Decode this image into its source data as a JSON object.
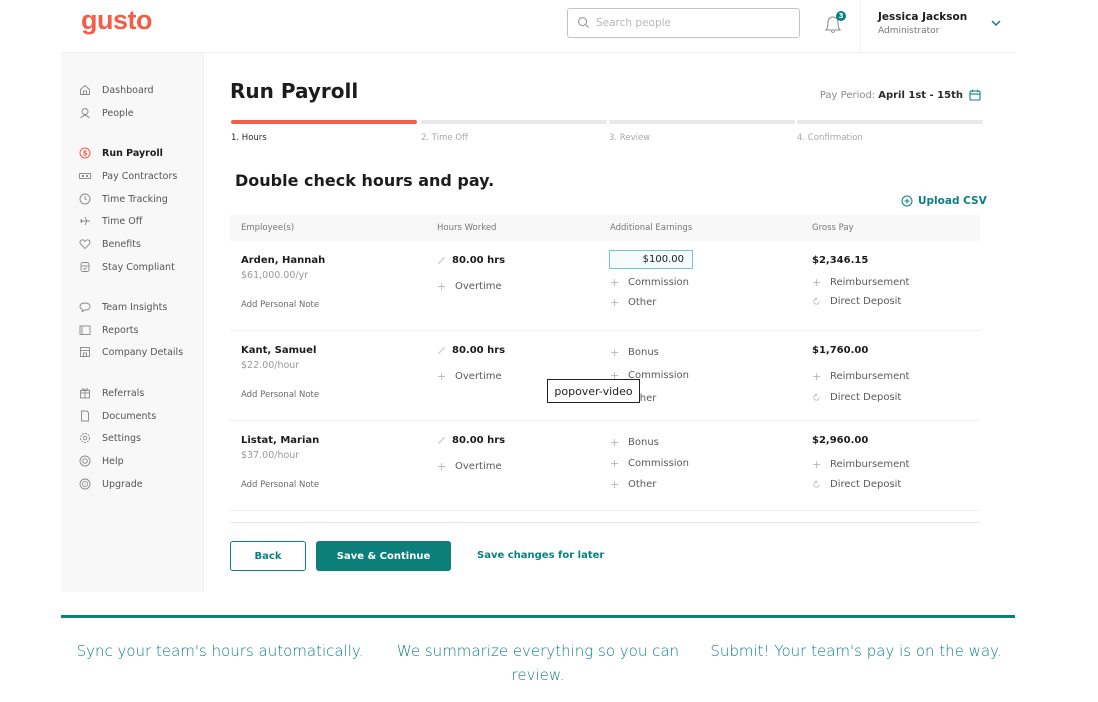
{
  "header": {
    "logo": "gusto",
    "search_placeholder": "Search people",
    "notifications_count": "3",
    "user_name": "Jessica Jackson",
    "user_role": "Administrator"
  },
  "sidebar": {
    "items": [
      {
        "label": "Dashboard",
        "icon": "home-icon"
      },
      {
        "label": "People",
        "icon": "person-icon"
      },
      {
        "label": "Run Payroll",
        "icon": "dollar-icon",
        "active": true
      },
      {
        "label": "Pay Contractors",
        "icon": "bill-icon"
      },
      {
        "label": "Time Tracking",
        "icon": "clock-icon"
      },
      {
        "label": "Time Off",
        "icon": "plane-icon"
      },
      {
        "label": "Benefits",
        "icon": "heart-icon"
      },
      {
        "label": "Stay Compliant",
        "icon": "shield-icon"
      },
      {
        "label": "Team Insights",
        "icon": "chat-icon"
      },
      {
        "label": "Reports",
        "icon": "folder-icon"
      },
      {
        "label": "Company Details",
        "icon": "store-icon"
      },
      {
        "label": "Referrals",
        "icon": "gift-icon"
      },
      {
        "label": "Documents",
        "icon": "document-icon"
      },
      {
        "label": "Settings",
        "icon": "gear-icon"
      },
      {
        "label": "Help",
        "icon": "lifebuoy-icon"
      },
      {
        "label": "Upgrade",
        "icon": "upgrade-icon"
      }
    ]
  },
  "main": {
    "title": "Run Payroll",
    "pay_period_label": "Pay Period:",
    "pay_period_value": "April 1st - 15th",
    "steps": [
      {
        "label": "1. Hours",
        "active": true
      },
      {
        "label": "2. Time Off"
      },
      {
        "label": "3. Review"
      },
      {
        "label": "4. Confirmation"
      }
    ],
    "progress_step": "1 of 4",
    "subtitle": "Double check hours and pay.",
    "upload_label": "Upload CSV",
    "columns": [
      "Employee(s)",
      "Hours Worked",
      "Additional Earnings",
      "Gross Pay"
    ],
    "rows": [
      {
        "name": "Arden, Hannah",
        "rate": "$61,000.00/yr",
        "note": "Add Personal Note",
        "hours": "80.00 hrs",
        "overtime": "Overtime",
        "earnings_input": "$100.00",
        "earnings": [
          "Commission",
          "Other"
        ],
        "gross": "$2,346.15",
        "reimbursement": "Reimbursement",
        "deposit": "Direct Deposit"
      },
      {
        "name": "Kant, Samuel",
        "rate": "$22.00/hour",
        "note": "Add Personal Note",
        "hours": "80.00 hrs",
        "overtime": "Overtime",
        "earnings": [
          "Bonus",
          "Commission",
          "Other"
        ],
        "gross": "$1,760.00",
        "reimbursement": "Reimbursement",
        "deposit": "Direct Deposit"
      },
      {
        "name": "Listat, Marian",
        "rate": "$37.00/hour",
        "note": "Add Personal Note",
        "hours": "80.00 hrs",
        "overtime": "Overtime",
        "earnings": [
          "Bonus",
          "Commission",
          "Other"
        ],
        "gross": "$2,960.00",
        "reimbursement": "Reimbursement",
        "deposit": "Direct Deposit"
      }
    ],
    "back_label": "Back",
    "save_continue_label": "Save & Continue",
    "save_later_label": "Save changes for later",
    "popover_label": "popover-video"
  },
  "features": [
    "Sync your team's hours automatically.",
    "We summarize everything so you can review.",
    "Submit! Your team's pay is on the way."
  ],
  "colors": {
    "brand": "#f45d48",
    "accent": "#0d7f7a"
  }
}
